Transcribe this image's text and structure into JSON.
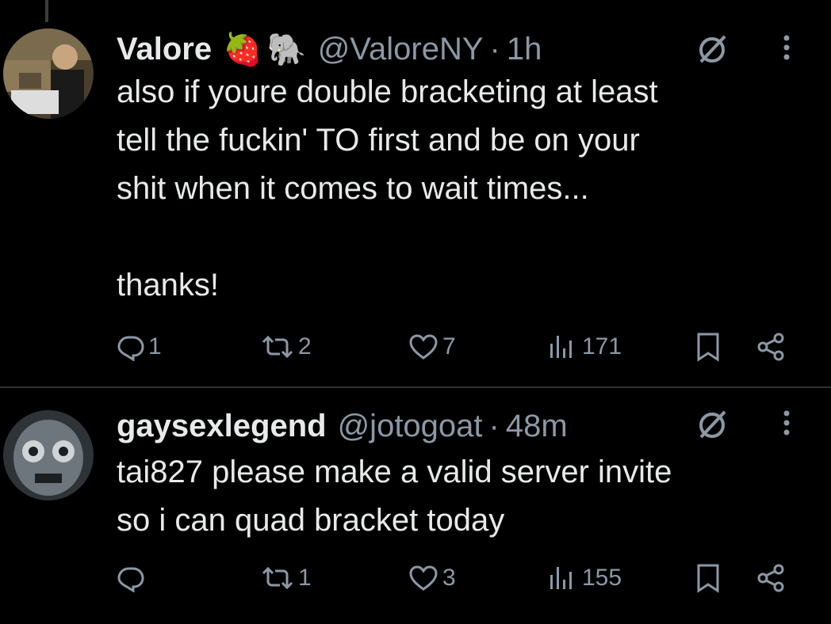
{
  "tweets": [
    {
      "name": "Valore",
      "emojis": [
        "🍓",
        "🐘"
      ],
      "handle": "@ValoreNY",
      "separator": "·",
      "time": "1h",
      "text": "also if youre double bracketing at least\ntell the fuckin' TO first and be on your\nshit when it comes to wait times...\n\nthanks!",
      "replies": "1",
      "reposts": "2",
      "likes": "7",
      "views": "171",
      "avatar_color": "#6b5a3a"
    },
    {
      "name": "gaysexlegend",
      "handle": "@jotogoat",
      "separator": "·",
      "time": "48m",
      "text": "tai827 please make a valid server invite\nso i can quad bracket today",
      "replies": "",
      "reposts": "1",
      "likes": "3",
      "views": "155",
      "avatar_color": "#5e6670"
    }
  ],
  "icons": {
    "reply": "reply-icon",
    "repost": "repost-icon",
    "like": "heart-icon",
    "views": "views-icon",
    "bookmark": "bookmark-icon",
    "share": "share-icon",
    "grok": "grok-icon",
    "more": "more-icon"
  },
  "colors": {
    "background": "#000000",
    "text": "#e7e9ea",
    "secondary": "#8b98a5",
    "divider": "#2f3336"
  }
}
